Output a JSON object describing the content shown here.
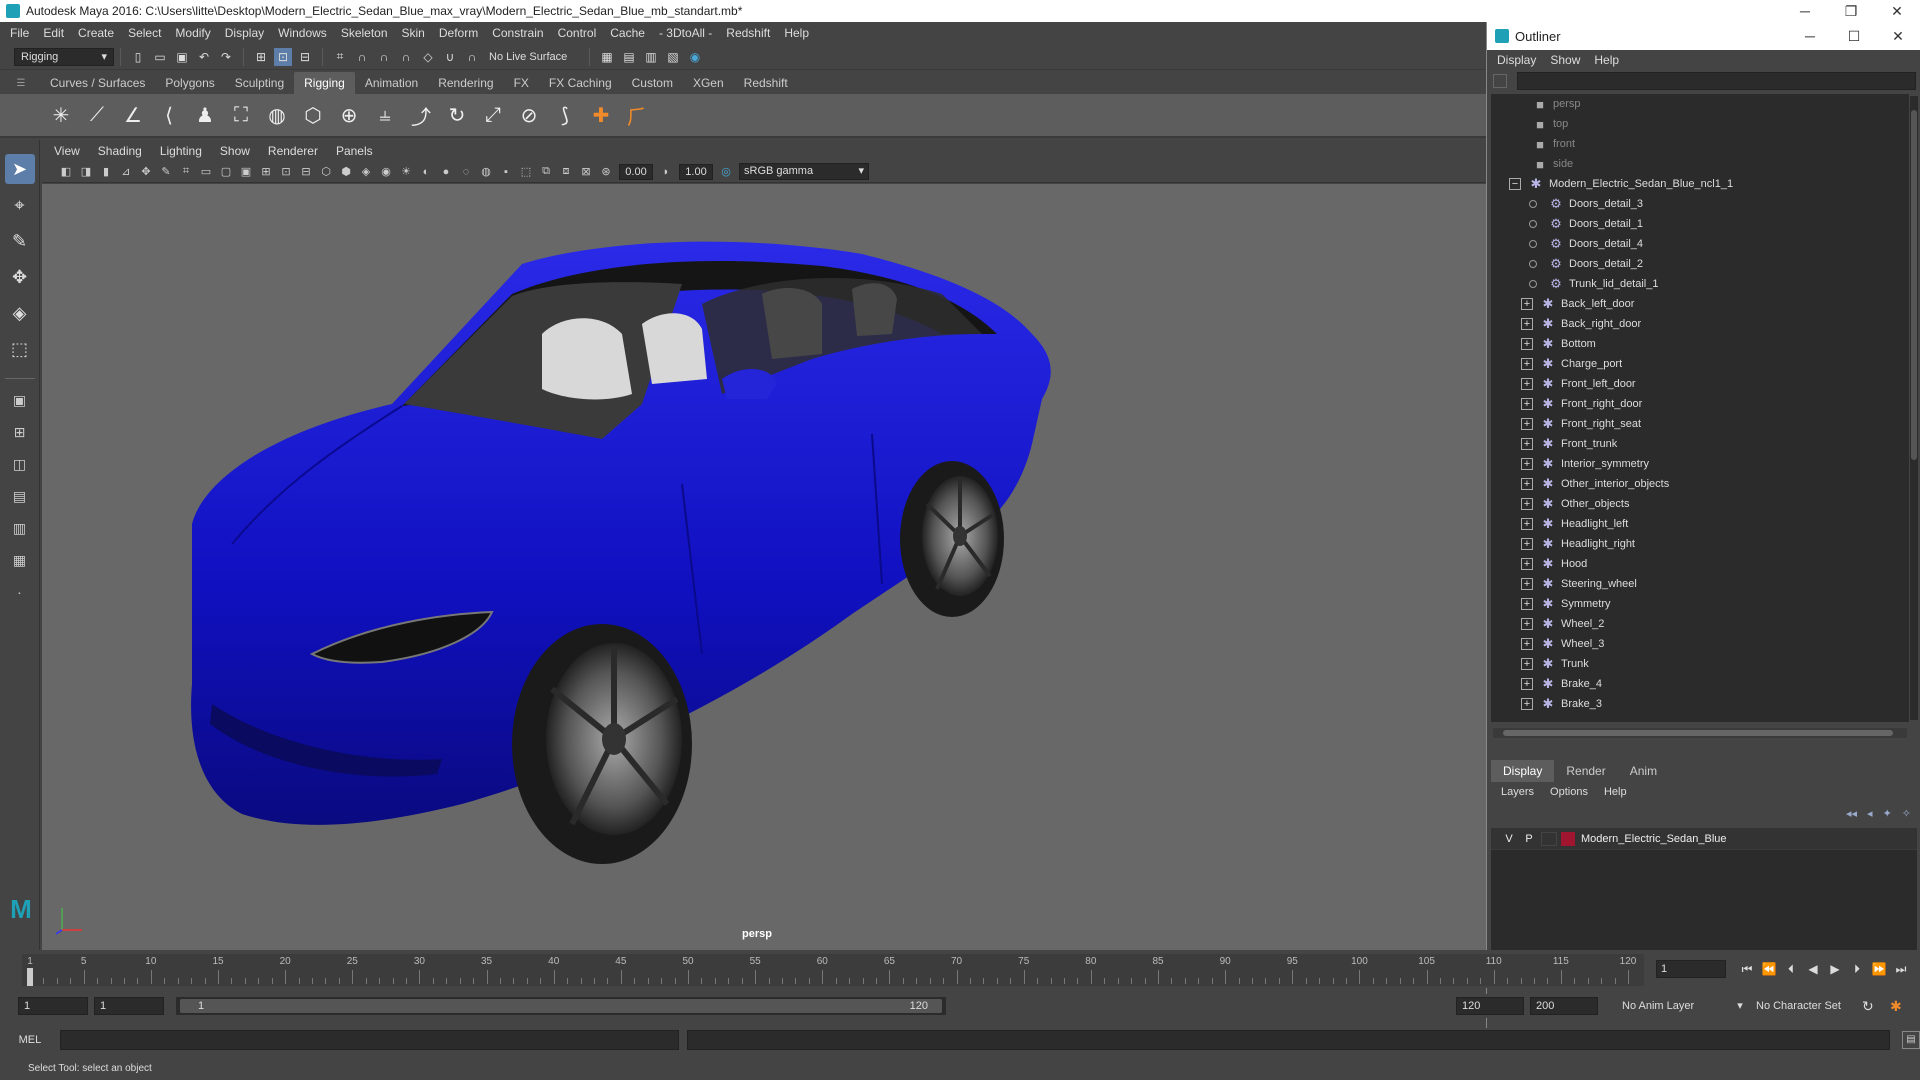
{
  "window": {
    "title": "Autodesk Maya 2016: C:\\Users\\litte\\Desktop\\Modern_Electric_Sedan_Blue_max_vray\\Modern_Electric_Sedan_Blue_mb_standart.mb*"
  },
  "menubar": [
    "File",
    "Edit",
    "Create",
    "Select",
    "Modify",
    "Display",
    "Windows",
    "Skeleton",
    "Skin",
    "Deform",
    "Constrain",
    "Control",
    "Cache",
    "- 3DtoAll -",
    "Redshift",
    "Help"
  ],
  "statusline": {
    "menuset": "Rigging",
    "live_surface": "No Live Surface"
  },
  "shelf": {
    "tabs": [
      "Curves / Surfaces",
      "Polygons",
      "Sculpting",
      "Rigging",
      "Animation",
      "Rendering",
      "FX",
      "FX Caching",
      "Custom",
      "XGen",
      "Redshift"
    ],
    "active_tab": "Rigging"
  },
  "viewport": {
    "menu": [
      "View",
      "Shading",
      "Lighting",
      "Show",
      "Renderer",
      "Panels"
    ],
    "exposure": "0.00",
    "gamma": "1.00",
    "color_space": "sRGB gamma",
    "camera": "persp",
    "car_color": "#1010c8"
  },
  "outliner": {
    "title": "Outliner",
    "menu": [
      "Display",
      "Show",
      "Help"
    ],
    "cameras": [
      "persp",
      "top",
      "front",
      "side"
    ],
    "root": "Modern_Electric_Sedan_Blue_ncl1_1",
    "details": [
      "Doors_detail_3",
      "Doors_detail_1",
      "Doors_detail_4",
      "Doors_detail_2",
      "Trunk_lid_detail_1"
    ],
    "groups": [
      "Back_left_door",
      "Back_right_door",
      "Bottom",
      "Charge_port",
      "Front_left_door",
      "Front_right_door",
      "Front_right_seat",
      "Front_trunk",
      "Interior_symmetry",
      "Other_interior_objects",
      "Other_objects",
      "Headlight_left",
      "Headlight_right",
      "Hood",
      "Steering_wheel",
      "Symmetry",
      "Wheel_2",
      "Wheel_3",
      "Trunk",
      "Brake_4",
      "Brake_3"
    ]
  },
  "layers": {
    "tabs": [
      "Display",
      "Render",
      "Anim"
    ],
    "active_tab": "Display",
    "menu": [
      "Layers",
      "Options",
      "Help"
    ],
    "row": {
      "v": "V",
      "p": "P",
      "name": "Modern_Electric_Sedan_Blue",
      "color": "#a01530"
    }
  },
  "timeline": {
    "ticks": [
      "1",
      "5",
      "10",
      "15",
      "20",
      "25",
      "30",
      "35",
      "40",
      "45",
      "50",
      "55",
      "60",
      "65",
      "70",
      "75",
      "80",
      "85",
      "90",
      "95",
      "100",
      "105",
      "110",
      "115",
      "120"
    ],
    "current_frame": "1"
  },
  "range": {
    "start": "1",
    "playback_start": "1",
    "slider_left": "1",
    "slider_right": "120",
    "playback_end": "120",
    "end": "200",
    "anim_layer": "No Anim Layer",
    "character_set": "No Character Set"
  },
  "cmdline": {
    "label": "MEL"
  },
  "helpline": "Select Tool: select an object"
}
